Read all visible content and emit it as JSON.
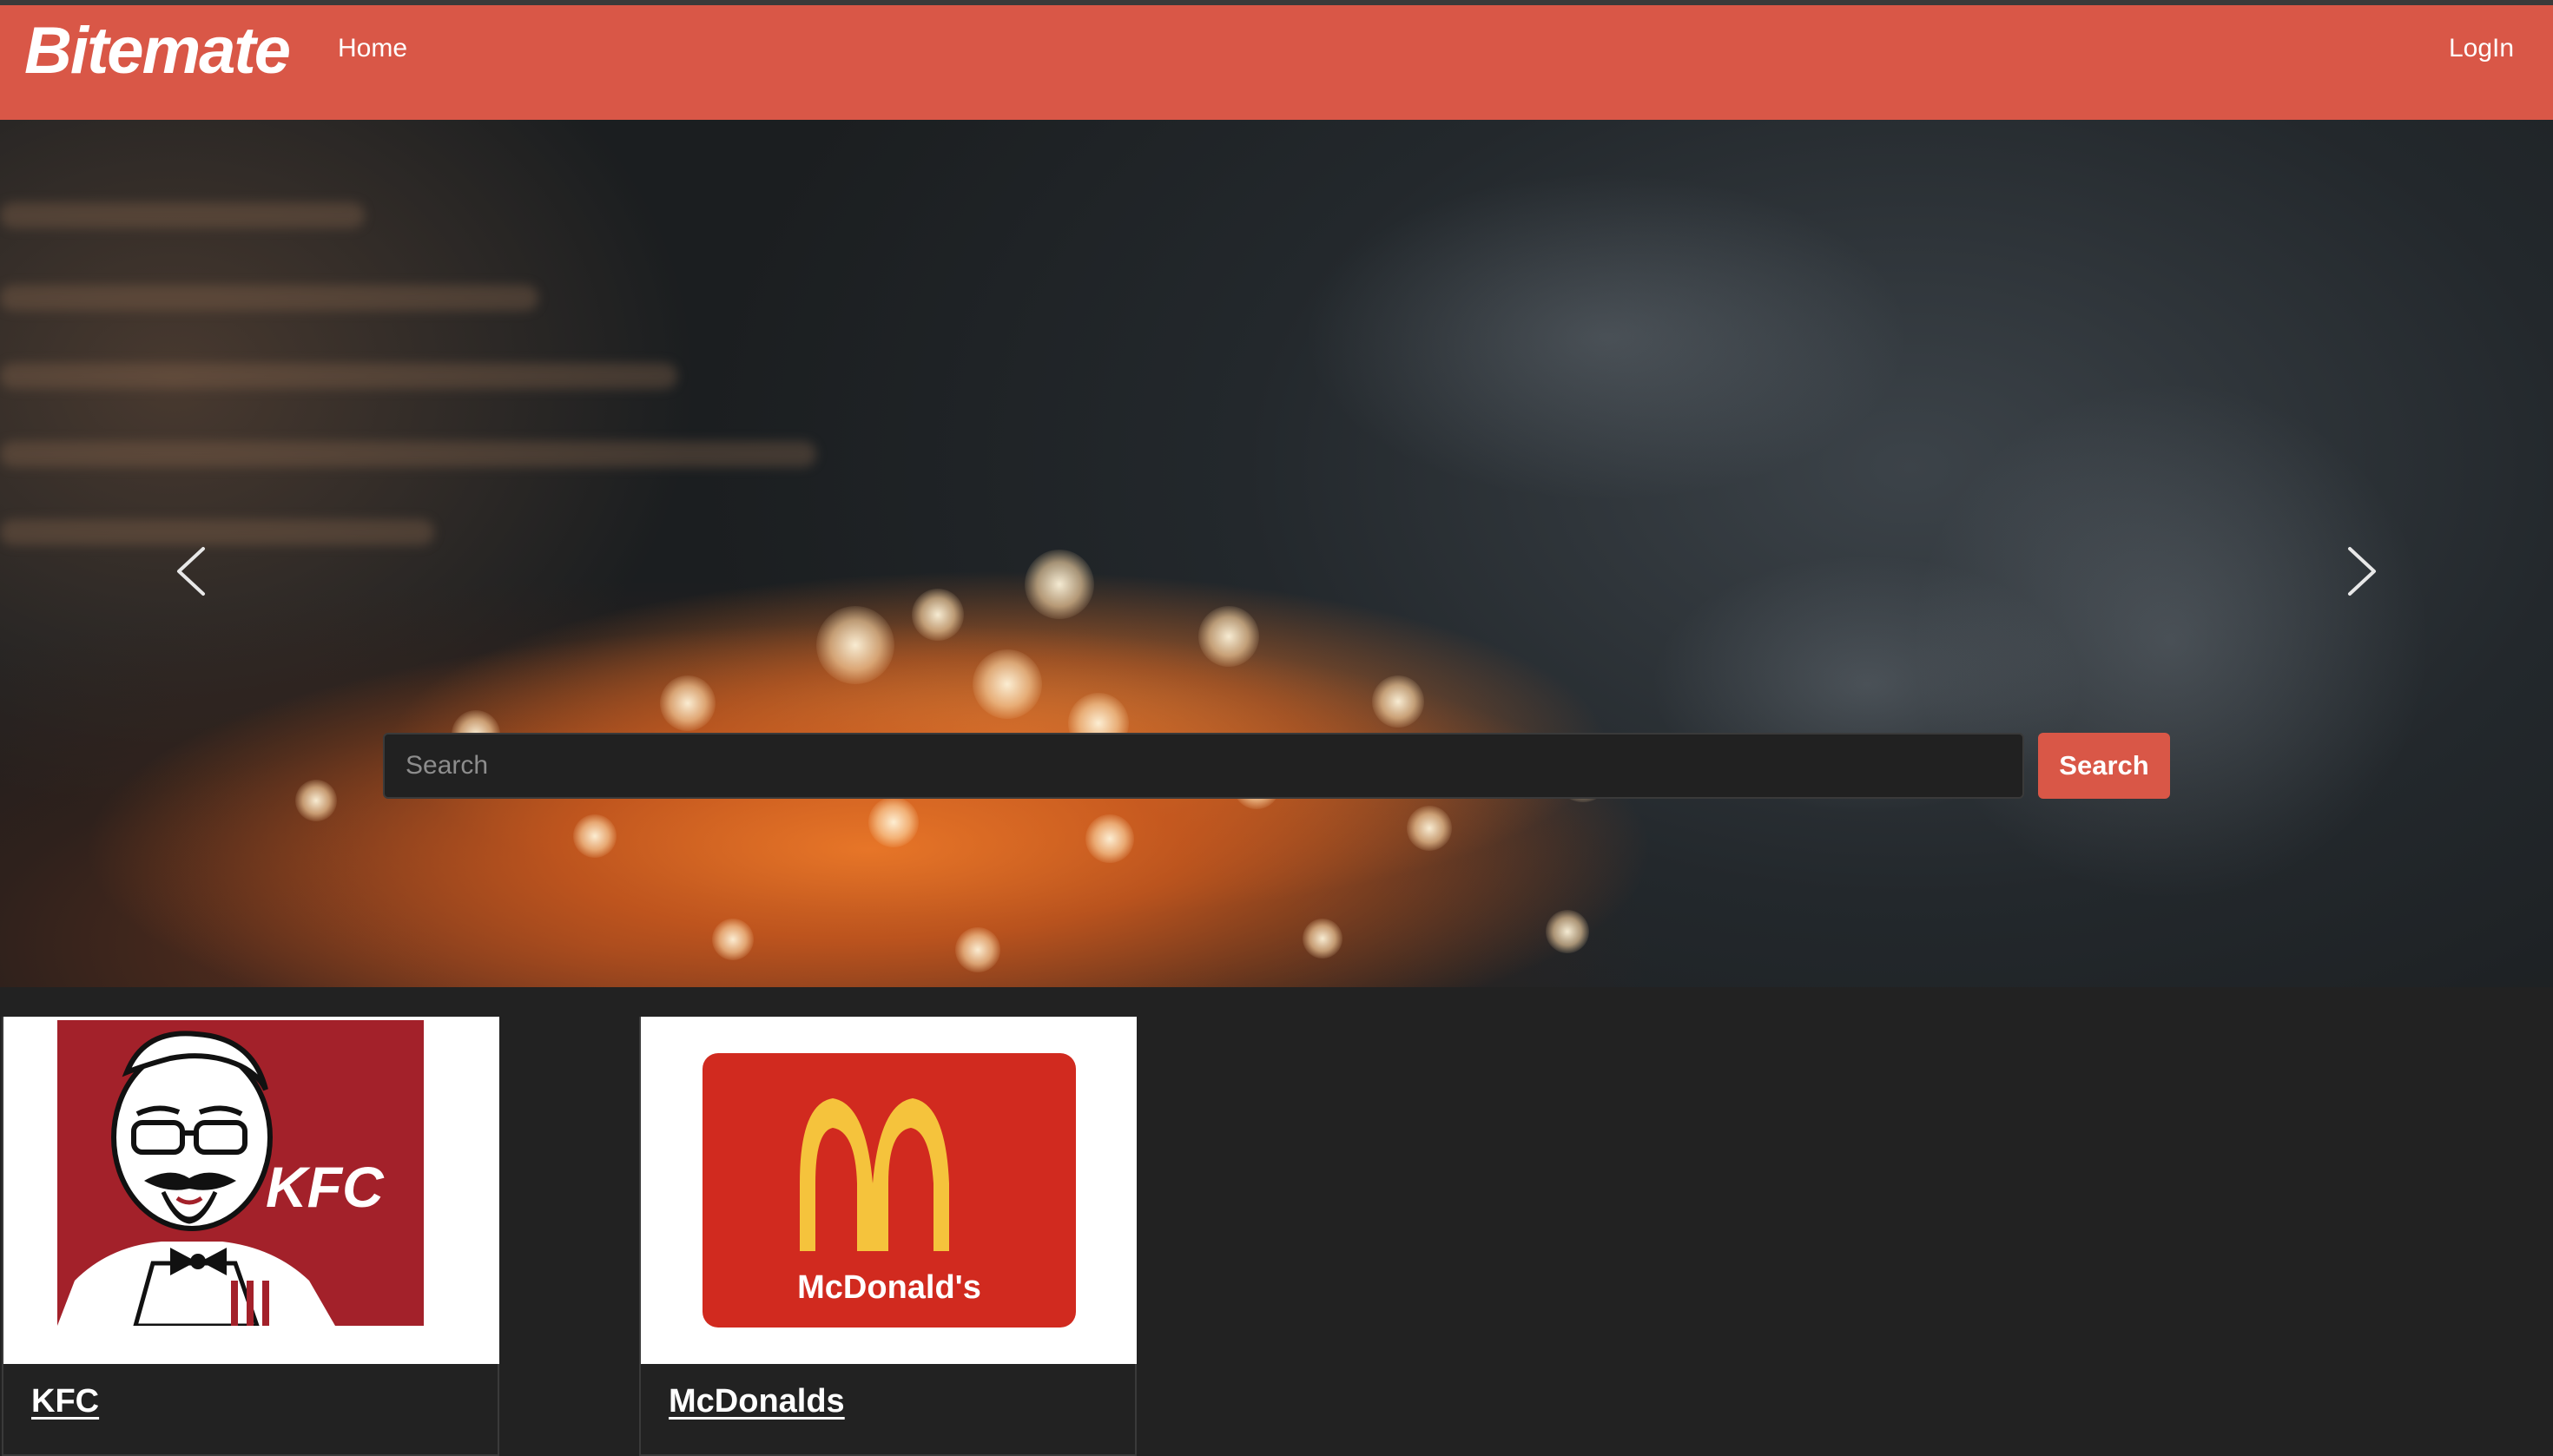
{
  "navbar": {
    "brand": "Bitemate",
    "home_label": "Home",
    "login_label": "LogIn",
    "color": "#d95747"
  },
  "hero": {
    "prev_icon": "chevron-left-icon",
    "next_icon": "chevron-right-icon"
  },
  "search": {
    "placeholder": "Search",
    "value": "",
    "button_label": "Search"
  },
  "restaurants": [
    {
      "name": "KFC",
      "logo_text": "KFC"
    },
    {
      "name": "McDonalds",
      "logo_text": "McDonald's"
    }
  ],
  "colors": {
    "accent": "#d95747",
    "background": "#222222",
    "kfc_red": "#a3212a",
    "mcd_red": "#d12a1f",
    "mcd_yellow": "#f5c33c"
  }
}
